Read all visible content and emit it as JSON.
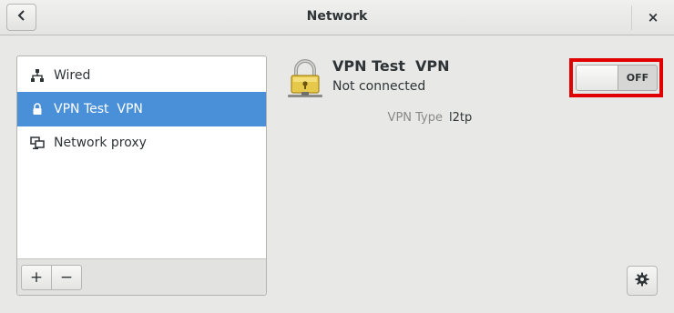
{
  "window": {
    "title": "Network"
  },
  "titlebar": {
    "back_icon": "chevron-left-icon",
    "close_label": "×"
  },
  "sidebar": {
    "items": [
      {
        "label": "Wired",
        "icon": "wired-network-icon",
        "selected": false
      },
      {
        "label": "VPN Test  VPN",
        "icon": "vpn-icon",
        "selected": true
      },
      {
        "label": "Network proxy",
        "icon": "network-proxy-icon",
        "selected": false
      }
    ],
    "add_label": "+",
    "remove_label": "−"
  },
  "detail": {
    "name": "VPN Test  VPN",
    "status": "Not connected",
    "type_label": "VPN Type",
    "type_value": "l2tp",
    "toggle_label": "OFF",
    "toggle_on": false
  },
  "colors": {
    "accent": "#4a90d9",
    "highlight": "#e00000"
  }
}
